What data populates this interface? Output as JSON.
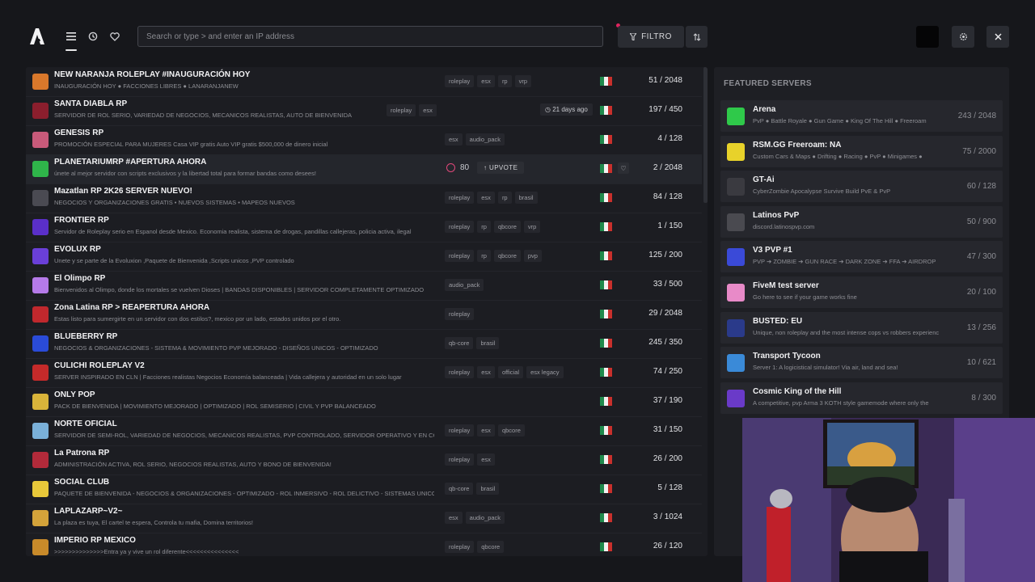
{
  "nav": {
    "tabs": [
      "list-icon",
      "history-icon",
      "heart-icon"
    ],
    "search_placeholder": "Search or type > and enter an IP address",
    "filter_label": "FILTRO"
  },
  "servers": [
    {
      "name": "NEW NARANJA ROLEPLAY #INAUGURACIÓN HOY",
      "desc": "INAUGURACIÓN HOY ● FACCIONES LIBRES ● LANARANJANEW",
      "tags": [
        "roleplay",
        "esx",
        "rp",
        "vrp"
      ],
      "players": "51 / 2048",
      "color": "#d9782b"
    },
    {
      "name": "SANTA DIABLA RP",
      "desc": "SERVIDOR DE ROL SERIO, VARIEDAD DE NEGOCIOS, MECANICOS REALISTAS, AUTO DE BIENVENIDA",
      "tags": [
        "roleplay",
        "esx"
      ],
      "players": "197 / 450",
      "time": "21 days ago",
      "color": "#8b1e2d"
    },
    {
      "name": "GENESIS RP",
      "desc": "PROMOCIÓN ESPECIAL PARA MUJERES Casa VIP gratis Auto VIP gratis $500,000 de dinero inicial",
      "tags": [
        "esx",
        "audio_pack"
      ],
      "players": "4 / 128",
      "color": "#c85a7a"
    },
    {
      "name": "PLANETARIUMRP #APERTURA AHORA",
      "desc": "únete al mejor servidor con scripts exclusivos y la libertad total para formar bandas como desees!",
      "tags": [],
      "players": "2 / 2048",
      "upvotes": "80",
      "upvote_label": "UPVOTE",
      "color": "#2fb54a"
    },
    {
      "name": "Mazatlan RP 2K26 SERVER NUEVO!",
      "desc": "NEGOCIOS Y ORGANIZACIONES GRATIS • NUEVOS SISTEMAS • MAPEOS NUEVOS",
      "tags": [
        "roleplay",
        "esx",
        "rp",
        "brasil"
      ],
      "players": "84 / 128",
      "color": "#4a4a52"
    },
    {
      "name": "FRONTIER RP",
      "desc": "Servidor de Roleplay serio en Espanol desde Mexico. Economia realista, sistema de drogas, pandillas callejeras, policia activa, ilegal",
      "tags": [
        "roleplay",
        "rp",
        "qbcore",
        "vrp"
      ],
      "players": "1 / 150",
      "color": "#5a2fc9"
    },
    {
      "name": "EVOLUX RP",
      "desc": "Unete y se parte de la Evoluxion ,Paquete de Bienvenida ,Scripts unicos ,PVP controlado",
      "tags": [
        "roleplay",
        "rp",
        "qbcore",
        "pvp"
      ],
      "players": "125 / 200",
      "color": "#6a3fd8"
    },
    {
      "name": "El Olimpo RP",
      "desc": "Bienvenidos al Olimpo, donde los mortales se vuelven Dioses | BANDAS DISPONIBLES | SERVIDOR COMPLETAMENTE OPTIMIZADO",
      "tags": [
        "audio_pack"
      ],
      "players": "33 / 500",
      "color": "#b57ae8"
    },
    {
      "name": "Zona Latina RP > REAPERTURA AHORA",
      "desc": "Estas listo para sumergirte en un servidor con dos estilos?, mexico por un lado, estados unidos por el otro.",
      "tags": [
        "roleplay"
      ],
      "players": "29 / 2048",
      "color": "#c0282d"
    },
    {
      "name": "BLUEBERRY RP",
      "desc": "NEGOCIOS & ORGANIZACIONES - SISTEMA & MOVIMIENTO PVP MEJORADO - DISEÑOS UNICOS - OPTIMIZADO",
      "tags": [
        "qb-core",
        "brasil"
      ],
      "players": "245 / 350",
      "color": "#2a4bd8"
    },
    {
      "name": "CULICHI ROLEPLAY V2",
      "desc": "SERVER INSPIRADO EN CLN | Facciones realistas Negocios Economía balanceada | Vida callejera y autoridad en un solo lugar",
      "tags": [
        "roleplay",
        "esx",
        "official",
        "esx legacy"
      ],
      "players": "74 / 250",
      "color": "#c42a2a"
    },
    {
      "name": "ONLY POP",
      "desc": "PACK DE BIENVENIDA | MOVIMIENTO MEJORADO | OPTIMIZADO | ROL SEMISERIO | CIVIL Y PVP BALANCEADO",
      "tags": [],
      "players": "37 / 190",
      "color": "#d9b43a"
    },
    {
      "name": "NORTE OFICIAL",
      "desc": "SERVIDOR DE SEMI-ROL, VARIEDAD DE NEGOCIOS, MECANICOS REALISTAS, PVP CONTROLADO, SERVIDOR OPERATIVO Y EN CONSTANTE",
      "tags": [
        "roleplay",
        "esx",
        "qbcore"
      ],
      "players": "31 / 150",
      "color": "#7ab0d8"
    },
    {
      "name": "La Patrona RP",
      "desc": "ADMINISTRACIÓN ACTIVA, ROL SERIO, NEGOCIOS REALISTAS, AUTO Y BONO DE BIENVENIDA!",
      "tags": [
        "roleplay",
        "esx"
      ],
      "players": "26 / 200",
      "color": "#b22a3a"
    },
    {
      "name": "SOCIAL CLUB",
      "desc": "PAQUETE DE BIENVENIDA - NEGOCIOS & ORGANIZACIONES - OPTIMIZADO - ROL INMERSIVO - ROL DELICTIVO - SISTEMAS UNICOS",
      "tags": [
        "qb-core",
        "brasil"
      ],
      "players": "5 / 128",
      "color": "#e8c83a"
    },
    {
      "name": "LAPLAZARP~V2~",
      "desc": "La plaza es tuya, El cartel te espera, Controla tu mafia, Domina territorios!",
      "tags": [
        "esx",
        "audio_pack"
      ],
      "players": "3 / 1024",
      "color": "#d4a33a"
    },
    {
      "name": "IMPERIO RP MEXICO",
      "desc": ">>>>>>>>>>>>>>Entra ya y vive un rol diferente<<<<<<<<<<<<<<<",
      "tags": [
        "roleplay",
        "qbcore"
      ],
      "players": "26 / 120",
      "color": "#c88a2a"
    }
  ],
  "featured": {
    "title": "FEATURED SERVERS",
    "items": [
      {
        "name": "Arena",
        "desc": "PvP ● Battle Royale ● Gun Game ● King Of The Hill ● Freeroam",
        "players": "243 / 2048",
        "color": "#2fc94a"
      },
      {
        "name": "RSM.GG Freeroam: NA",
        "desc": "Custom Cars & Maps ● Drifting ● Racing ● PvP ● Minigames ●",
        "players": "75 / 2000",
        "color": "#e8d22a"
      },
      {
        "name": "GT-Ai",
        "desc": "CyberZombie Apocalypse Survive Build PvE & PvP",
        "players": "60 / 128",
        "color": "#3a3a40"
      },
      {
        "name": "Latinos PvP",
        "desc": "discord.latinospvp.com",
        "players": "50 / 900",
        "color": "#4a4a50"
      },
      {
        "name": "V3 PVP #1",
        "desc": "PVP ➔ ZOMBIE ➔ GUN RACE ➔ DARK ZONE ➔ FFA ➔ AIRDROP",
        "players": "47 / 300",
        "color": "#3a4ad8"
      },
      {
        "name": "FiveM test server",
        "desc": "Go here to see if your game works fine",
        "players": "20 / 100",
        "color": "#e88ac8"
      },
      {
        "name": "BUSTED: EU",
        "desc": "Unique, non roleplay and the most intense cops vs robbers experience",
        "players": "13 / 256",
        "color": "#2a3a8a"
      },
      {
        "name": "Transport Tycoon",
        "desc": "Server 1: A logicistical simulator! Via air, land and sea!",
        "players": "10 / 621",
        "color": "#3a8ad8"
      },
      {
        "name": "Cosmic King of the Hill",
        "desc": "A competitive, pvp Arma 3 KOTH style gamemode where only the",
        "players": "8 / 300",
        "color": "#6a3ac8"
      }
    ]
  },
  "colors": {
    "flag_green": "#1f8a4c",
    "flag_white": "#f2f2f2",
    "flag_red": "#c9302c",
    "upvote_pink": "#e0487a"
  }
}
